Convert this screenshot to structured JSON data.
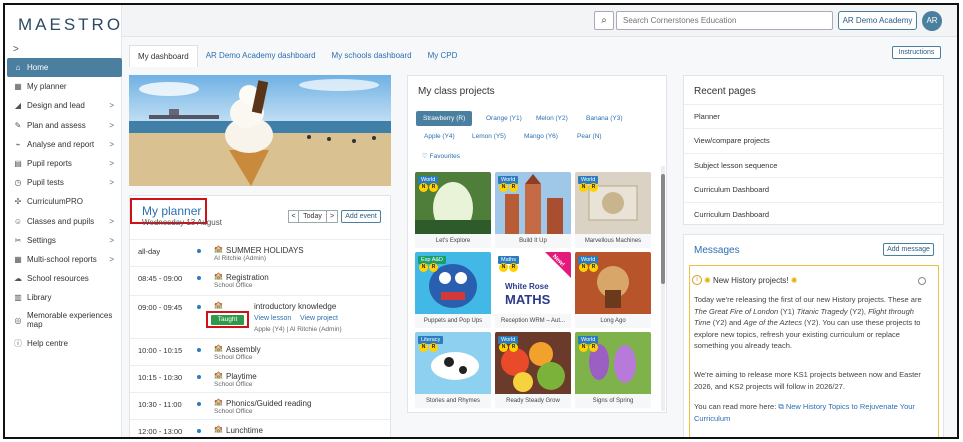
{
  "app": {
    "logo": "MAESTRO"
  },
  "sidebar": {
    "collapse_glyph": ">",
    "items": [
      {
        "label": "Home",
        "icon": "home-icon",
        "glyph": "⌂",
        "arrow": ""
      },
      {
        "label": "My planner",
        "icon": "calendar-icon",
        "glyph": "▦",
        "arrow": ""
      },
      {
        "label": "Design and lead",
        "icon": "design-icon",
        "glyph": "◢",
        "arrow": ">"
      },
      {
        "label": "Plan and assess",
        "icon": "pencil-icon",
        "glyph": "✎",
        "arrow": ">"
      },
      {
        "label": "Analyse and report",
        "icon": "chart-icon",
        "glyph": "⌁",
        "arrow": ">"
      },
      {
        "label": "Pupil reports",
        "icon": "report-icon",
        "glyph": "▤",
        "arrow": ">"
      },
      {
        "label": "Pupil tests",
        "icon": "clock-icon",
        "glyph": "◷",
        "arrow": ">"
      },
      {
        "label": "CurriculumPRO",
        "icon": "network-icon",
        "glyph": "✣",
        "arrow": ""
      },
      {
        "label": "Classes and pupils",
        "icon": "users-icon",
        "glyph": "☺",
        "arrow": ">"
      },
      {
        "label": "Settings",
        "icon": "wrench-icon",
        "glyph": "✂",
        "arrow": ">"
      },
      {
        "label": "Multi-school reports",
        "icon": "multi-report-icon",
        "glyph": "▦",
        "arrow": ">"
      },
      {
        "label": "School resources",
        "icon": "cloud-icon",
        "glyph": "☁",
        "arrow": ""
      },
      {
        "label": "Library",
        "icon": "library-icon",
        "glyph": "▥",
        "arrow": ""
      },
      {
        "label": "Memorable experiences map",
        "icon": "compass-icon",
        "glyph": "◎",
        "arrow": ""
      },
      {
        "label": "Help centre",
        "icon": "info-icon",
        "glyph": "ⓘ",
        "arrow": ""
      }
    ]
  },
  "topbar": {
    "search_glyph": "⌕",
    "search_placeholder": "Search Cornerstones Education",
    "school_label": "AR Demo Academy",
    "avatar_initials": "AR"
  },
  "tabs": [
    "My dashboard",
    "AR Demo Academy dashboard",
    "My schools dashboard",
    "My CPD"
  ],
  "instructions_label": "Instructions",
  "planner": {
    "title": "My planner",
    "date": "Wednesday 13 August",
    "prev": "<",
    "today": "Today",
    "next": ">",
    "add_event": "Add event",
    "events": [
      {
        "time": "all-day",
        "title": "SUMMER HOLIDAYS",
        "sub": "Al Ritchie (Admin)"
      },
      {
        "time": "08:45 - 09:00",
        "title": "Registration",
        "sub": "School Office"
      },
      {
        "time": "09:00 - 09:45",
        "title": "introductory knowledge",
        "sub": "Apple (Y4) | Al Ritchie (Admin)",
        "badge": "Taught",
        "links": [
          "View lesson",
          "View project"
        ]
      },
      {
        "time": "10:00 - 10:15",
        "title": "Assembly",
        "sub": "School Office"
      },
      {
        "time": "10:15 - 10:30",
        "title": "Playtime",
        "sub": "School Office"
      },
      {
        "time": "10:30 - 11:00",
        "title": "Phonics/Guided reading",
        "sub": "School Office"
      },
      {
        "time": "12:00 - 13:00",
        "title": "Lunchtime",
        "sub": ""
      }
    ]
  },
  "projects": {
    "title": "My class projects",
    "class_tabs": [
      "Strawberry (R)",
      "Orange (Y1)",
      "Melon (Y2)",
      "Banana (Y3)",
      "Apple (Y4)",
      "Lemon (Y5)",
      "Mango (Y6)",
      "Pear (N)"
    ],
    "favourites": "Favourites",
    "tiles": [
      {
        "caption": "Let's Explore",
        "badge": "World",
        "badge_color": "#2b7bbd",
        "art": "cave"
      },
      {
        "caption": "Build It Up",
        "badge": "World",
        "badge_color": "#2b7bbd",
        "art": "city"
      },
      {
        "caption": "Marvellous Machines",
        "badge": "World",
        "badge_color": "#2b7bbd",
        "art": "machine"
      },
      {
        "caption": "Puppets and Pop Ups",
        "badge": "Exp A&D",
        "badge_color": "#1a9e6b",
        "art": "puppet"
      },
      {
        "caption": "Reception WRM – Aut...",
        "badge": "Maths",
        "badge_color": "#2b7bbd",
        "art": "maths",
        "title_line1": "White Rose",
        "title_line2": "MATHS",
        "ribbon": "New!"
      },
      {
        "caption": "Long Ago",
        "badge": "World",
        "badge_color": "#2b7bbd",
        "art": "longago"
      },
      {
        "caption": "Stories and Rhymes",
        "badge": "Literacy",
        "badge_color": "#2b7bbd",
        "art": "cow"
      },
      {
        "caption": "Ready Steady Grow",
        "badge": "World",
        "badge_color": "#2b7bbd",
        "art": "veg"
      },
      {
        "caption": "Signs of Spring",
        "badge": "World",
        "badge_color": "#2b7bbd",
        "art": "spring"
      }
    ]
  },
  "recent": {
    "title": "Recent pages",
    "items": [
      "Planner",
      "View/compare projects",
      "Subject lesson sequence",
      "Curriculum Dashboard",
      "Curriculum Dashboard"
    ]
  },
  "messages": {
    "title": "Messages",
    "add_label": "Add message",
    "message": {
      "heading": "New History projects!",
      "p1_a": "Today we're releasing the first of our new History projects. These are ",
      "p1_t1": "The Great Fire of London",
      "p1_b": " (Y1) ",
      "p1_t2": "Titanic Tragedy",
      "p1_c": " (Y2), ",
      "p1_t3": "Flight through Time",
      "p1_d": " (Y2) and ",
      "p1_t4": "Age of the Aztecs",
      "p1_e": " (Y2). You can use these projects to explore new topics, refresh your existing curriculum or replace something you already teach.",
      "p2": "We're aiming to release more KS1 projects between now and Easter 2026, and KS2 projects will follow in 2026/27.",
      "p3_a": "You can read more here: ",
      "p3_link": "New History Topics to Rejuvenate Your Curriculum"
    }
  },
  "colors": {
    "accent": "#4a7fa0",
    "link": "#2c6fb0",
    "highlight_box": "#d1111a",
    "taught": "#2e9a4a",
    "message_border": "#f0c040"
  }
}
